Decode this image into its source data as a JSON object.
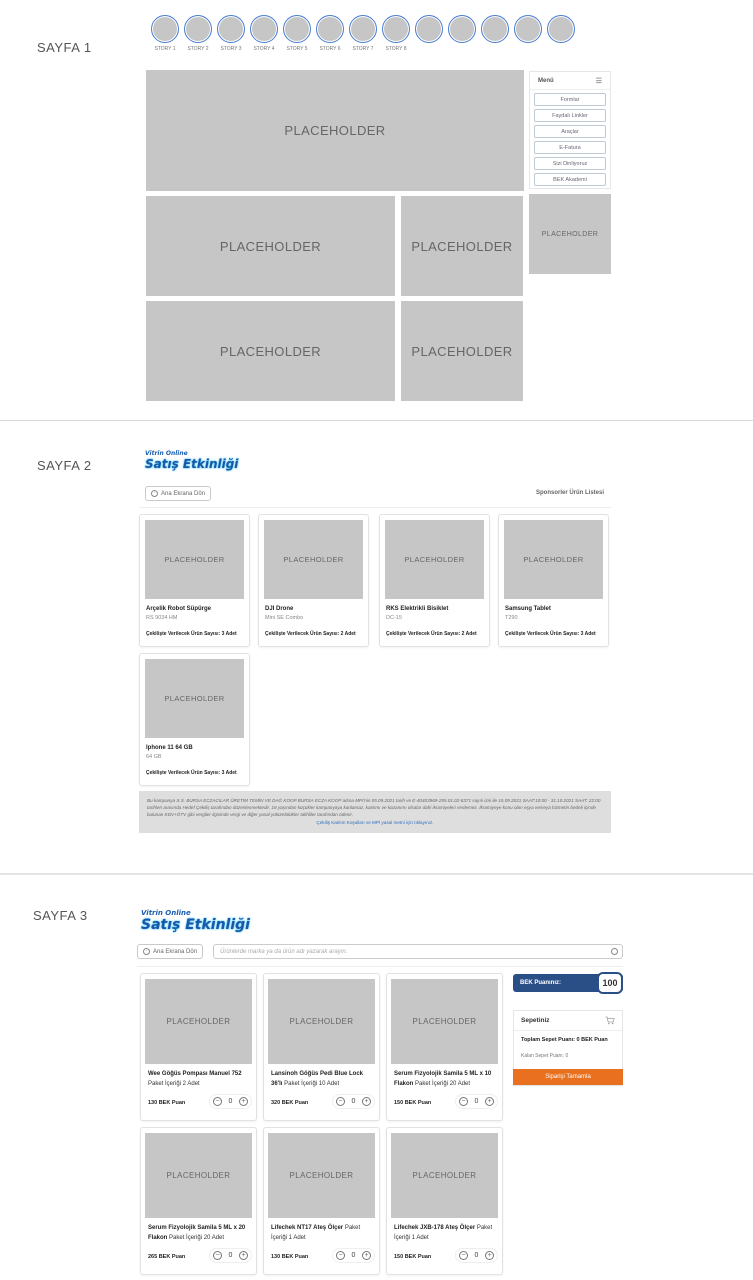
{
  "page1": {
    "label": "SAYFA 1",
    "stories": [
      "STORY 1",
      "STORY 2",
      "STORY 3",
      "STORY 4",
      "STORY 5",
      "STORY 6",
      "STORY 7",
      "STORY 8",
      "",
      "",
      "",
      "",
      ""
    ],
    "placeholder": "PLACEHOLDER",
    "menu": {
      "title": "Menü",
      "items": [
        "Formlar",
        "Faydalı Linkler",
        "Araçlar",
        "E-Fatura",
        "Sizi Dinliyoruz",
        "BEK Akademi"
      ]
    }
  },
  "page2": {
    "label": "SAYFA 2",
    "logo": {
      "top": "Vitrin Online",
      "main": "Satış Etkinliği"
    },
    "back_button": "Ana Ekrana Dön",
    "list_title": "Sponsorler Ürün Listesi",
    "placeholder": "PLACEHOLDER",
    "products": [
      {
        "name": "Arçelik Robot Süpürge",
        "model": "RS 9034 HM",
        "count": "Çekilişte Verilecek Ürün Sayısı: 3 Adet"
      },
      {
        "name": "DJI Drone",
        "model": "Mini SE Combo",
        "count": "Çekilişte Verilecek Ürün Sayısı: 2 Adet"
      },
      {
        "name": "RKS Elektrikli Bisiklet",
        "model": "DC-15",
        "count": "Çekilişte Verilecek Ürün Sayısı: 2 Adet"
      },
      {
        "name": "Samsung Tablet",
        "model": "T290",
        "count": "Çekilişte Verilecek Ürün Sayısı: 3 Adet"
      },
      {
        "name": "Iphone 11 64 GB",
        "model": "64 GB",
        "count": "Çekilişte Verilecek Ürün Sayısı: 3 Adet"
      }
    ],
    "notice": "Bu kampanya S.S. BURSA ECZACILAR ÜRETİM TEMİN VE DAĞ KOOP BURSA ECZA KOOP adına MPİ'nin 05.09.2021 tarih ve E-40403969-255.01.02-8371 sayılı izni ile 15.09.2021 SAAT:10:00 - 31.10.2021 SAAT: 22:00 tarihleri arasında Hedef Çekiliş tarafından düzenlenmektedir. 18 yaşından küçükler kampanyaya katılamaz, katılımı ve kazanımı olsalar dahi ikramiyeleri verilemez. İkramiyeye konu olan eşya ve/veya hizmetin bedeli içinde bulunan KDV+ÖTV gibi vergiler ilgisinde vergi ve diğer yasal yükümlülükler talihliler tarafından ödenir.",
    "notice_link": "Çekiliş Katılım Koşulları ve MPİ yasal metni için tıklayınız."
  },
  "page3": {
    "label": "SAYFA 3",
    "logo": {
      "top": "Vitrin Online",
      "main": "Satış Etkinliği"
    },
    "back_button": "Ana Ekrana Dön",
    "search_placeholder": "Ürünlerde marka ya da ürün adı yazarak arayın.",
    "placeholder": "PLACEHOLDER",
    "products": [
      {
        "name": "Wee Göğüs Pompası Manuel 752",
        "pack": "Paket İçeriği 2 Adet",
        "points": "130 BEK Puan",
        "qty": "0"
      },
      {
        "name": "Lansinoh Göğüs Pedi Blue Lock 36'lı",
        "pack": "Paket İçeriği 10 Adet",
        "points": "320 BEK Puan",
        "qty": "0"
      },
      {
        "name": "Serum Fizyolojik Samila 5 ML x 10 Flakon",
        "pack": "Paket İçeriği 20 Adet",
        "points": "150 BEK Puan",
        "qty": "0"
      },
      {
        "name": "Serum Fizyolojik Samila 5 ML x 20 Flakon",
        "pack": "Paket İçeriği 20 Adet",
        "points": "265 BEK Puan",
        "qty": "0"
      },
      {
        "name": "Lifechek NT17 Ateş Ölçer",
        "pack": "Paket İçeriği 1 Adet",
        "points": "130 BEK Puan",
        "qty": "0"
      },
      {
        "name": "Lifechek JXB-178 Ateş Ölçer",
        "pack": "Paket İçeriği 1 Adet",
        "points": "150 BEK Puan",
        "qty": "0"
      }
    ],
    "points_label": "BEK Puanınız:",
    "points_value": "100",
    "basket": {
      "title": "Sepetiniz",
      "total": "Toplam Sepet Puanı: 0 BEK Puan",
      "remaining": "Kalan Sepet Puanı: 0",
      "button": "Siparişi Tamamla"
    }
  },
  "colors": {
    "story_ring": "#4a7fd4",
    "placeholder": "#c6c6c6",
    "accent_orange": "#e8701f",
    "points_blue": "#2a4f86",
    "link_blue": "#2d6fbf"
  }
}
